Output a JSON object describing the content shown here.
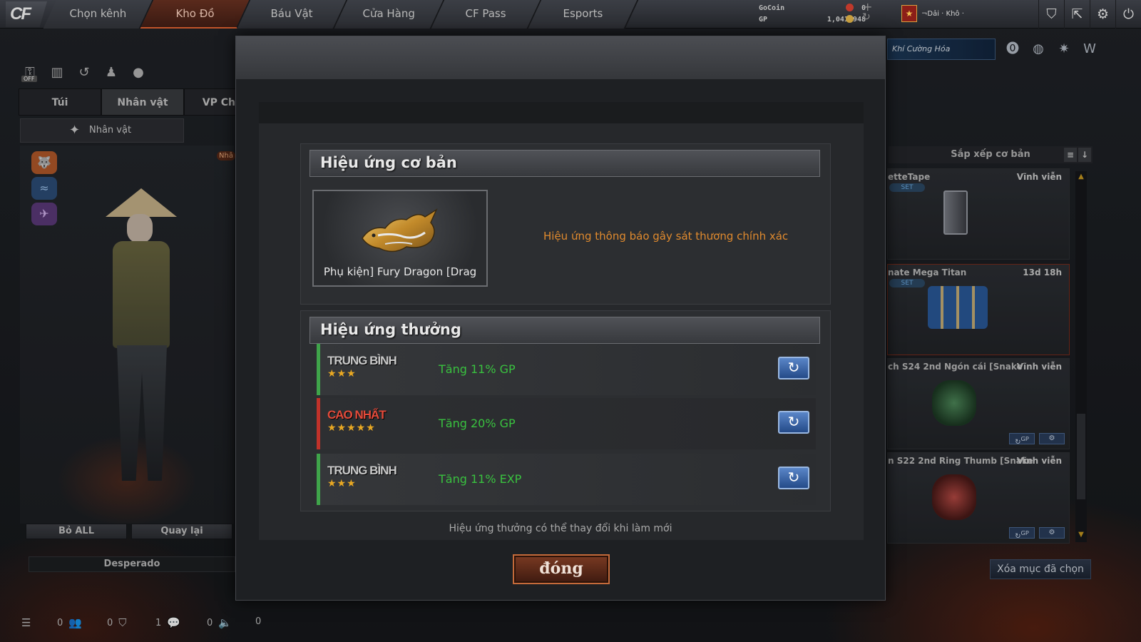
{
  "nav": {
    "tabs": [
      "Chọn kênh",
      "Kho Đồ",
      "Báu Vật",
      "Cửa Hàng",
      "CF Pass",
      "Esports"
    ],
    "active_index": 1
  },
  "currency": {
    "gocoin_label": "GoCoin",
    "gocoin_value": "0",
    "gp_label": "GP",
    "gp_value": "1,041,948"
  },
  "user": {
    "name": "¬Dải · Khô ·"
  },
  "left_panel": {
    "off_label": "OFF",
    "tabs": [
      "Túi",
      "Nhân vật",
      "VP Chức"
    ],
    "active_tab": 1,
    "filter_label": "Nhân vật",
    "buttons": {
      "remove_all": "Bỏ ALL",
      "back": "Quay lại"
    },
    "character_name": "Desperado",
    "side_tag": "Nhâ"
  },
  "status_bar": {
    "counts": [
      "0",
      "0",
      "1",
      "0",
      "0"
    ]
  },
  "right_panel": {
    "weapon_banner": "Khí Cường Hóa",
    "sort_label": "Sắp xếp cơ bản",
    "items": [
      {
        "name": "etteTape",
        "duration": "Vĩnh viễn",
        "tag": "SET"
      },
      {
        "name": "nate Mega Titan",
        "duration": "13d 18h",
        "tag": "SET"
      },
      {
        "name": "ch S24 2nd Ngón cái [Snake",
        "duration": "Vĩnh viễn",
        "tag": ""
      },
      {
        "name": "n S22 2nd Ring Thumb [Snake",
        "duration": "Vĩnh viễn",
        "tag": ""
      }
    ],
    "clear_button": "Xóa mục đã chọn"
  },
  "modal": {
    "basic_section_title": "Hiệu ứng cơ bản",
    "item_label": "Phụ kiện] Fury Dragon [Drag",
    "basic_effect": "Hiệu ứng thông báo gây sát thương chính xác",
    "bonus_section_title": "Hiệu ứng thưởng",
    "bonus_effects": [
      {
        "grade": "TRUNG BÌNH",
        "stars": "★★★",
        "effect": "Tăng 11% GP"
      },
      {
        "grade": "CAO NHẤT",
        "stars": "★★★★★",
        "effect": "Tăng 20% GP"
      },
      {
        "grade": "TRUNG BÌNH",
        "stars": "★★★",
        "effect": "Tăng 11% EXP"
      }
    ],
    "footnote": "Hiệu ứng thưởng có thể thay đổi khi làm mới",
    "close_label": "đóng"
  }
}
